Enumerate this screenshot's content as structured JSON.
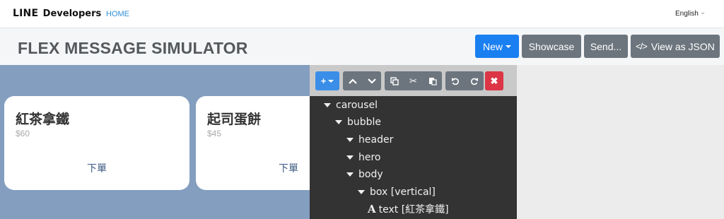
{
  "nav": {
    "logo_brand": "LINE",
    "logo_product": "Developers",
    "home_label": "HOME",
    "language": "English"
  },
  "header": {
    "title": "FLEX MESSAGE SIMULATOR",
    "buttons": {
      "new_label": "New",
      "showcase_label": "Showcase",
      "send_label": "Send...",
      "view_json_label": "View as JSON"
    }
  },
  "preview": {
    "background_color": "#849ebf",
    "cards": [
      {
        "title": "紅茶拿鐵",
        "price": "$60",
        "action": "下單"
      },
      {
        "title": "起司蛋餅",
        "price": "$45",
        "action": "下單"
      }
    ]
  },
  "editor": {
    "toolbar": {
      "add_icon": "plus-icon",
      "up_icon": "chevron-up-icon",
      "down_icon": "chevron-down-icon",
      "copy_icon": "copy-icon",
      "cut_icon": "scissors-icon",
      "paste_icon": "paste-icon",
      "undo_icon": "undo-icon",
      "redo_icon": "redo-icon",
      "delete_icon": "close-icon"
    },
    "tree": [
      {
        "label": "carousel",
        "depth": 0
      },
      {
        "label": "bubble",
        "depth": 1
      },
      {
        "label": "header",
        "depth": 2
      },
      {
        "label": "hero",
        "depth": 2
      },
      {
        "label": "body",
        "depth": 2
      },
      {
        "label": "box [vertical]",
        "depth": 3
      },
      {
        "label": "text [紅茶拿鐵]",
        "depth": 4,
        "icon": "text-icon"
      }
    ]
  },
  "colors": {
    "primary": "#1a7ff0",
    "secondary": "#6c757d",
    "danger": "#dc3545",
    "editor_bg": "#333333"
  }
}
